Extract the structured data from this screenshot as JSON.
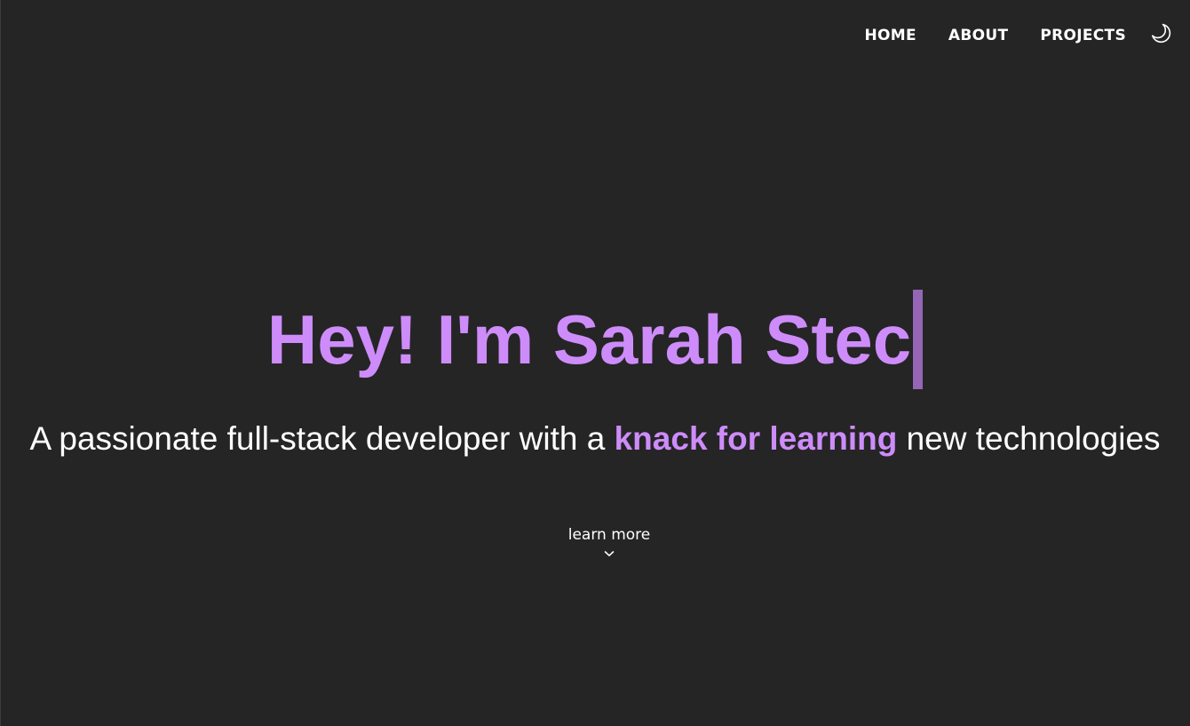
{
  "nav": {
    "items": [
      {
        "label": "HOME"
      },
      {
        "label": "ABOUT"
      },
      {
        "label": "PROJECTS"
      }
    ],
    "theme_icon": "moon-icon"
  },
  "hero": {
    "title": "Hey! I'm Sarah Stec",
    "tagline_before": "A passionate full-stack developer with a ",
    "tagline_highlight": "knack for learning",
    "tagline_after": " new technologies"
  },
  "cta": {
    "label": "learn more",
    "icon": "chevron-down-icon"
  },
  "colors": {
    "background": "#252525",
    "accent": "#cd8cfa",
    "cursor": "#9466b5",
    "text": "#ffffff"
  }
}
